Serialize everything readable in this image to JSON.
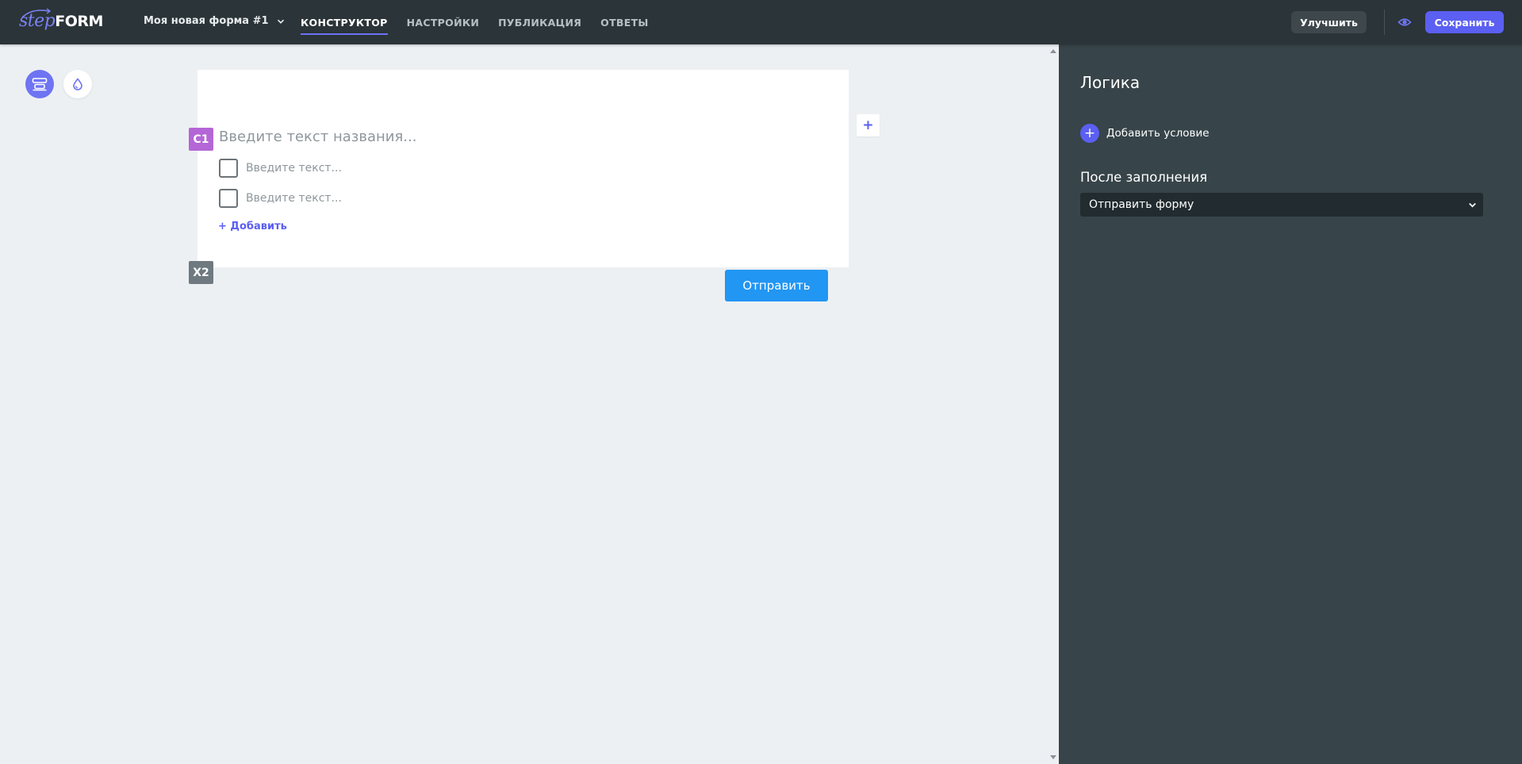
{
  "app": {
    "logo_step": "step",
    "logo_form": "FORM"
  },
  "header": {
    "form_title": "Моя новая форма #1",
    "tabs": [
      {
        "label": "КОНСТРУКТОР",
        "active": true
      },
      {
        "label": "НАСТРОЙКИ",
        "active": false
      },
      {
        "label": "ПУБЛИКАЦИЯ",
        "active": false
      },
      {
        "label": "ОТВЕТЫ",
        "active": false
      }
    ],
    "improve_label": "Улучшить",
    "save_label": "Сохранить"
  },
  "canvas": {
    "question": {
      "badge": "C1",
      "title_placeholder": "Введите текст названия...",
      "options": [
        {
          "placeholder": "Введите текст..."
        },
        {
          "placeholder": "Введите текст..."
        }
      ],
      "add_label": "+ Добавить"
    },
    "end_badge": "X2",
    "submit_label": "Отправить",
    "plus_label": "+"
  },
  "panel": {
    "title": "Логика",
    "add_condition_label": "Добавить условие",
    "add_condition_icon": "+",
    "after_fill_title": "После заполнения",
    "after_fill_selected": "Отправить форму"
  },
  "colors": {
    "topbar": "#2b3438",
    "accent": "#5b5ff2",
    "submit": "#2196f3",
    "panel": "#374449",
    "badge_question": "#b466d6",
    "badge_end": "#6e7a80"
  }
}
